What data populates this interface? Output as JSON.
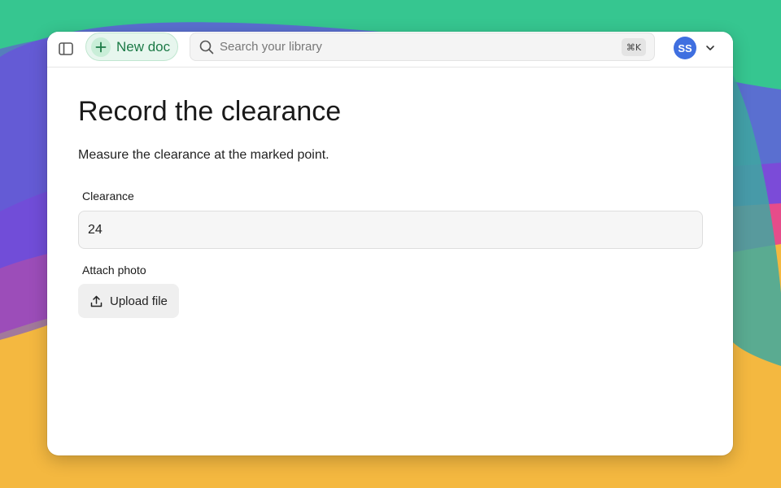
{
  "toolbar": {
    "sidebar_toggle_icon": "sidebar-toggle-icon",
    "new_doc_label": "New doc",
    "new_doc_icon": "plus-icon"
  },
  "search": {
    "placeholder": "Search your library",
    "shortcut": "⌘K",
    "icon": "search-icon"
  },
  "account": {
    "initials": "SS",
    "avatar_color": "#3f6fe0",
    "chevron_icon": "chevron-down-icon"
  },
  "main": {
    "title": "Record the clearance",
    "description": "Measure the clearance at the marked point.",
    "clearance": {
      "label": "Clearance",
      "value": "24"
    },
    "attach": {
      "label": "Attach photo",
      "button_label": "Upload file",
      "icon": "upload-icon"
    }
  },
  "colors": {
    "accent_green": "#1b7a46",
    "new_doc_bg": "#e7f6ee"
  }
}
